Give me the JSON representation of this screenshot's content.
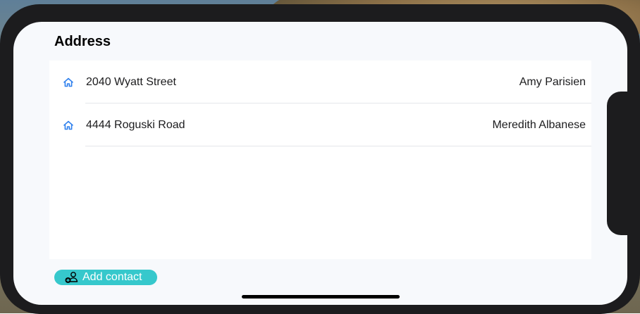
{
  "header": {
    "title": "Address"
  },
  "addresses": [
    {
      "street": "2040 Wyatt Street",
      "name": "Amy Parisien",
      "icon": "home-icon"
    },
    {
      "street": "4444 Roguski Road",
      "name": "Meredith Albanese",
      "icon": "home-icon"
    }
  ],
  "actions": {
    "add_contact_label": "Add contact",
    "add_contact_icon": "add-person-icon"
  },
  "colors": {
    "accent": "#36c8cc",
    "icon_blue": "#2f80ed"
  }
}
